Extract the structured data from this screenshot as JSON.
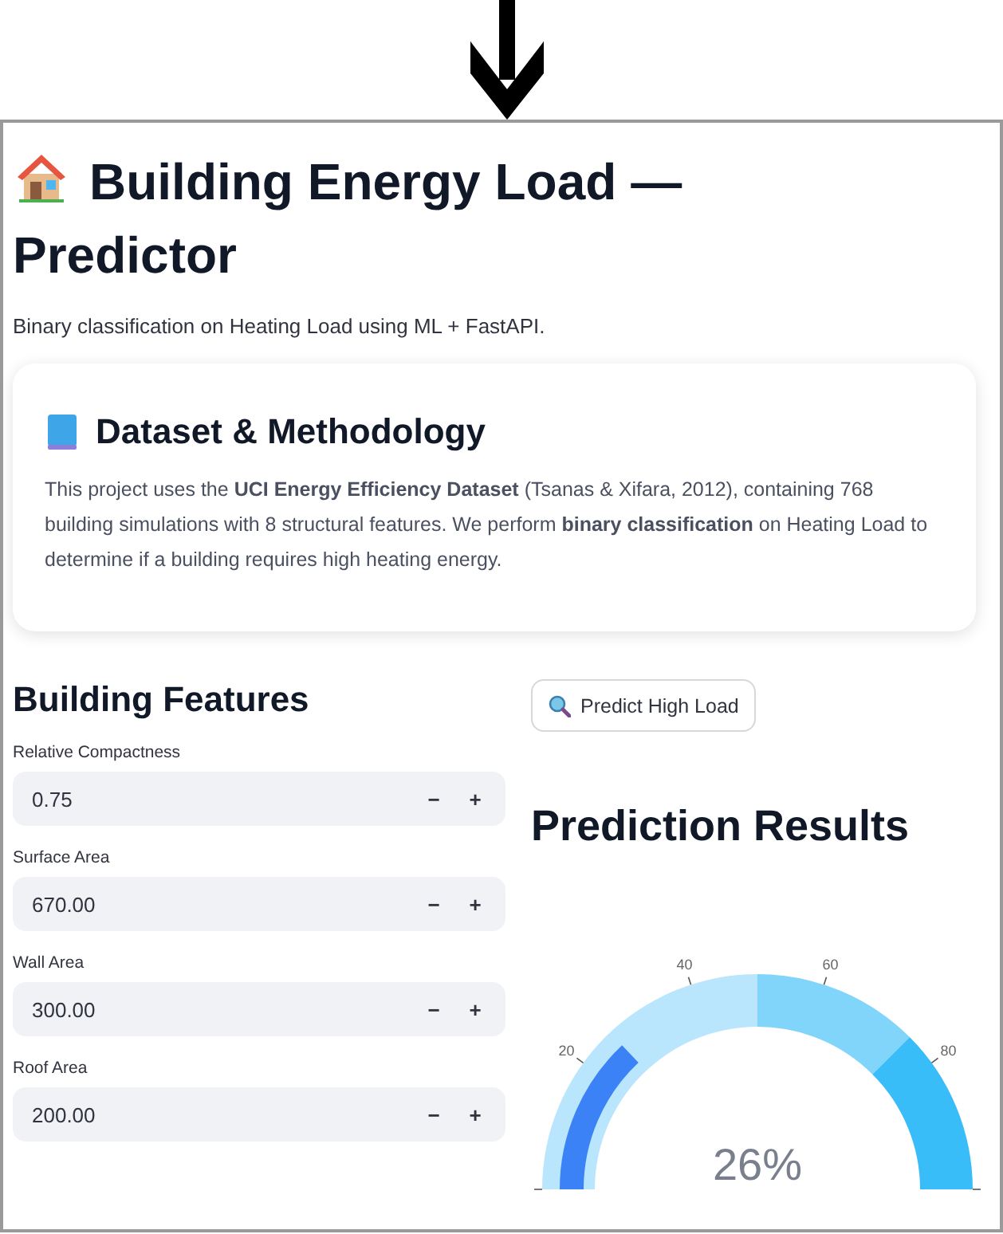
{
  "title": "Building Energy Load — Predictor",
  "subtitle": "Binary classification on Heating Load using ML + FastAPI.",
  "card": {
    "heading": "Dataset & Methodology",
    "text": "This project uses the **UCI Energy Efficiency Dataset** (Tsanas & Xifara, 2012), containing 768 building simulations with 8 structural features. We perform **binary classification** on Heating Load to determine if a building requires high heating energy."
  },
  "features": {
    "heading": "Building Features",
    "inputs": [
      {
        "label": "Relative Compactness",
        "value": "0.75",
        "decrement": "−",
        "increment": "+"
      },
      {
        "label": "Surface Area",
        "value": "670.00",
        "decrement": "−",
        "increment": "+"
      },
      {
        "label": "Wall Area",
        "value": "300.00",
        "decrement": "−",
        "increment": "+"
      },
      {
        "label": "Roof Area",
        "value": "200.00",
        "decrement": "−",
        "increment": "+"
      }
    ]
  },
  "predict_button": "Predict High Load",
  "results": {
    "heading": "Prediction Results",
    "gauge": {
      "level": 0.26,
      "reading": "26%",
      "ticks": [
        "20",
        "40",
        "60",
        "80"
      ]
    }
  }
}
